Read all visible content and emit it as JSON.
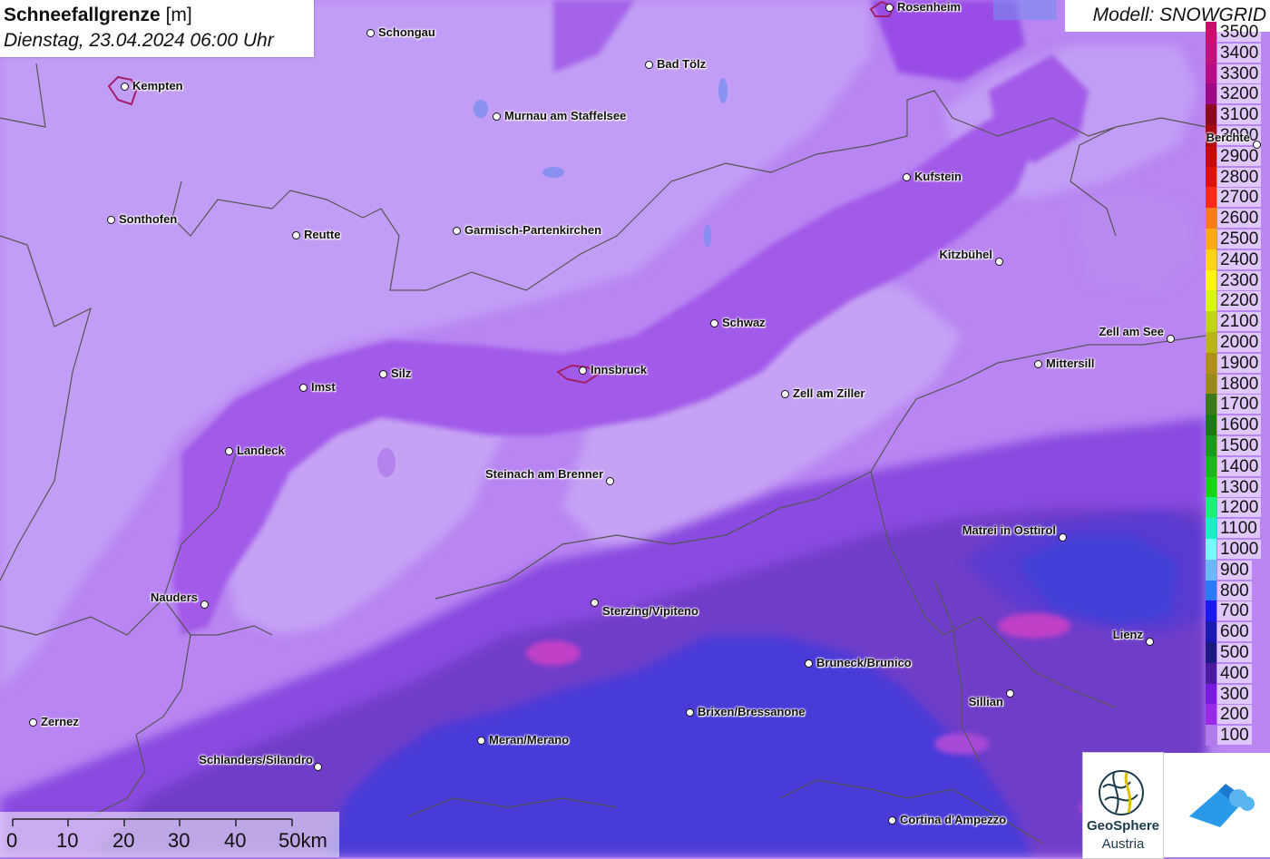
{
  "title": {
    "name": "Schneefallgrenze",
    "unit": "[m]",
    "datetime": "Dienstag, 23.04.2024 06:00 Uhr"
  },
  "model": "Modell: SNOWGRID",
  "legend": [
    {
      "label": "3500",
      "color": "#c8106a"
    },
    {
      "label": "3400",
      "color": "#c2117a"
    },
    {
      "label": "3300",
      "color": "#b80d84"
    },
    {
      "label": "3200",
      "color": "#9e0a86"
    },
    {
      "label": "3100",
      "color": "#8c0a1a"
    },
    {
      "label": "3000",
      "color": "#a50a10"
    },
    {
      "label": "2900",
      "color": "#c40a0a"
    },
    {
      "label": "2800",
      "color": "#e01010"
    },
    {
      "label": "2700",
      "color": "#ff2a1a"
    },
    {
      "label": "2600",
      "color": "#ff7a1a"
    },
    {
      "label": "2500",
      "color": "#ffa81a"
    },
    {
      "label": "2400",
      "color": "#ffd21a"
    },
    {
      "label": "2300",
      "color": "#fff21a"
    },
    {
      "label": "2200",
      "color": "#d8f51a"
    },
    {
      "label": "2100",
      "color": "#c2d41a"
    },
    {
      "label": "2000",
      "color": "#b8b41a"
    },
    {
      "label": "1900",
      "color": "#b08e1a"
    },
    {
      "label": "1800",
      "color": "#9a8a1a"
    },
    {
      "label": "1700",
      "color": "#3a7a1a"
    },
    {
      "label": "1600",
      "color": "#1a7a1a"
    },
    {
      "label": "1500",
      "color": "#1a9a1a"
    },
    {
      "label": "1400",
      "color": "#1ab81a"
    },
    {
      "label": "1300",
      "color": "#1ad21a"
    },
    {
      "label": "1200",
      "color": "#1af07a"
    },
    {
      "label": "1100",
      "color": "#1af0c2"
    },
    {
      "label": "1000",
      "color": "#7af8f8"
    },
    {
      "label": "900",
      "color": "#6ab8f8"
    },
    {
      "label": "800",
      "color": "#2a7af8"
    },
    {
      "label": "700",
      "color": "#1a1af0"
    },
    {
      "label": "600",
      "color": "#1a1ab0"
    },
    {
      "label": "500",
      "color": "#1a1a80"
    },
    {
      "label": "400",
      "color": "#4a1aa0"
    },
    {
      "label": "300",
      "color": "#7a1ae0"
    },
    {
      "label": "200",
      "color": "#9a2ae8"
    },
    {
      "label": "100",
      "color": "#b07cec"
    }
  ],
  "cities": [
    {
      "name": "Rosenheim"
    },
    {
      "name": "Schongau"
    },
    {
      "name": "Kempten"
    },
    {
      "name": "Bad Tölz"
    },
    {
      "name": "Murnau am Staffelsee"
    },
    {
      "name": "Berchte"
    },
    {
      "name": "Kufstein"
    },
    {
      "name": "Sonthofen"
    },
    {
      "name": "Reutte"
    },
    {
      "name": "Garmisch-Partenkirchen"
    },
    {
      "name": "Kitzbühel"
    },
    {
      "name": "Schwaz"
    },
    {
      "name": "Zell am See"
    },
    {
      "name": "Mittersill"
    },
    {
      "name": "Innsbruck"
    },
    {
      "name": "Silz"
    },
    {
      "name": "Imst"
    },
    {
      "name": "Zell am Ziller"
    },
    {
      "name": "Landeck"
    },
    {
      "name": "Steinach am Brenner"
    },
    {
      "name": "Matrei in Osttirol"
    },
    {
      "name": "Nauders"
    },
    {
      "name": "Sterzing/Vipiteno"
    },
    {
      "name": "Lienz"
    },
    {
      "name": "Bruneck/Brunico"
    },
    {
      "name": "Sillian"
    },
    {
      "name": "Brixen/Bressanone"
    },
    {
      "name": "Zernez"
    },
    {
      "name": "Meran/Merano"
    },
    {
      "name": "Schlanders/Silandro"
    },
    {
      "name": "Cortina d'Ampezzo"
    }
  ],
  "scale": {
    "ticks": [
      "0",
      "10",
      "20",
      "30",
      "40",
      "50km"
    ]
  },
  "logos": {
    "geosphere_line1": "GeoSphere",
    "geosphere_line2": "Austria"
  }
}
